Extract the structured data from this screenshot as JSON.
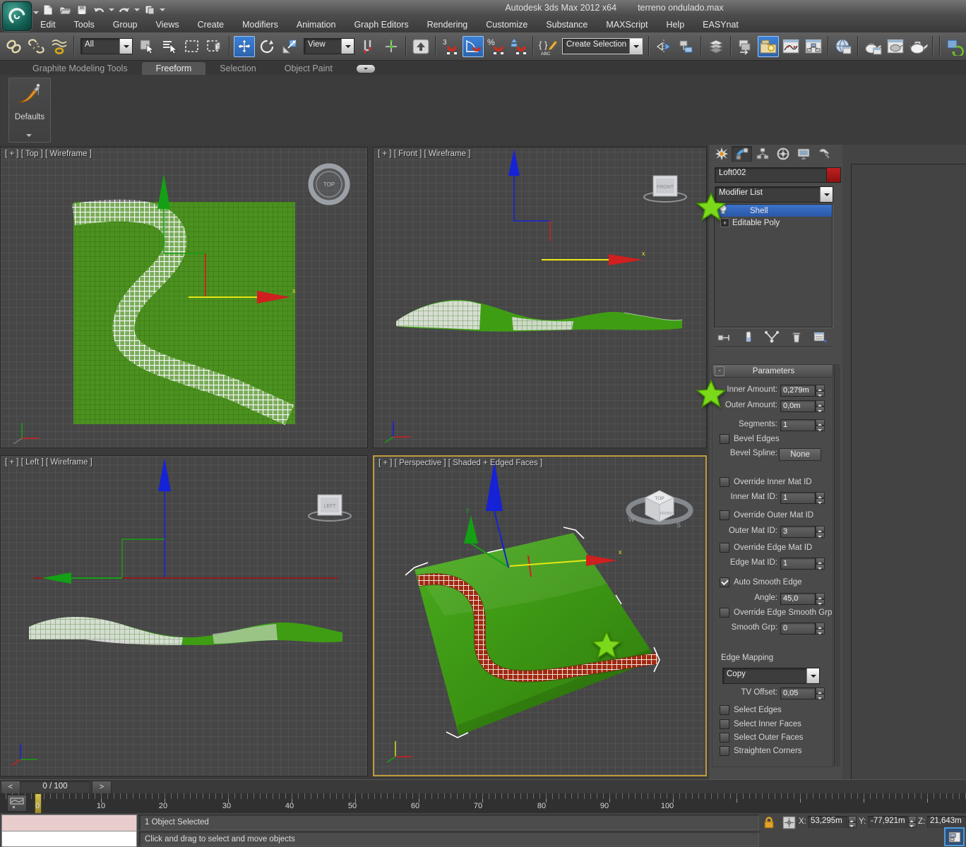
{
  "window": {
    "app_title": "Autodesk 3ds Max  2012 x64",
    "doc_title": "terreno ondulado.max"
  },
  "menu": {
    "items": [
      "Edit",
      "Tools",
      "Group",
      "Views",
      "Create",
      "Modifiers",
      "Animation",
      "Graph Editors",
      "Rendering",
      "Customize",
      "Substance",
      "MAXScript",
      "Help",
      "EASYnat"
    ]
  },
  "toolbar": {
    "selection_filter_value": "All",
    "ref_coord_value": "View",
    "named_selection_value": "Create Selection Se",
    "snap3_glyph": "3",
    "percent_glyph": "%",
    "abc_glyph": "ABC"
  },
  "ribbon": {
    "tabs": [
      "Graphite Modeling Tools",
      "Freeform",
      "Selection",
      "Object Paint"
    ],
    "defaults_label": "Defaults"
  },
  "viewports": {
    "top": {
      "label": "[ + ] [ Top ] [ Wireframe ]",
      "compass": "TOP",
      "axis_x": "x"
    },
    "front": {
      "label": "[ + ] [ Front ] [ Wireframe ]",
      "compass": "FRONT",
      "axis_x": "x"
    },
    "left": {
      "label": "[ + ] [ Left ] [ Wireframe ]",
      "compass": "LEFT"
    },
    "persp": {
      "label": "[ + ] [ Perspective ] [ Shaded + Edged Faces ]",
      "viewcube_top": "TOP",
      "viewcube_front": "FRONT",
      "viewcube_w": "W",
      "viewcube_s": "S",
      "axis_x": "x",
      "axis_y": "y"
    }
  },
  "command_panel": {
    "object_name": "Loft002",
    "modifier_list_label": "Modifier List",
    "stack_expand_glyph": "+",
    "stack": [
      {
        "label": "Shell"
      },
      {
        "label": "Editable Poly"
      }
    ],
    "rollout": {
      "collapse_glyph": "-",
      "title": "Parameters",
      "inner_amount_label": "Inner Amount:",
      "inner_amount_value": "0,279m",
      "outer_amount_label": "Outer Amount:",
      "outer_amount_value": "0,0m",
      "segments_label": "Segments:",
      "segments_value": "1",
      "bevel_edges_label": "Bevel Edges",
      "bevel_spline_label": "Bevel Spline:",
      "bevel_spline_value": "None",
      "override_inner_label": "Override Inner Mat ID",
      "inner_mat_label": "Inner Mat ID:",
      "inner_mat_value": "1",
      "override_outer_label": "Override Outer Mat ID",
      "outer_mat_label": "Outer Mat ID:",
      "outer_mat_value": "3",
      "override_edge_label": "Override Edge Mat ID",
      "edge_mat_label": "Edge Mat ID:",
      "edge_mat_value": "1",
      "auto_smooth_label": "Auto Smooth Edge",
      "angle_label": "Angle:",
      "angle_value": "45,0",
      "override_smooth_label": "Override Edge Smooth Grp",
      "smooth_grp_label": "Smooth Grp:",
      "smooth_grp_value": "0",
      "edge_mapping_label": "Edge Mapping",
      "edge_mapping_value": "Copy",
      "tv_offset_label": "TV Offset:",
      "tv_offset_value": "0,05",
      "select_edges_label": "Select Edges",
      "select_inner_label": "Select Inner Faces",
      "select_outer_label": "Select Outer Faces",
      "straighten_label": "Straighten Corners"
    }
  },
  "timeline": {
    "prev_glyph": "<",
    "next_glyph": ">",
    "frame_display": "0 / 100",
    "ticks": [
      "0",
      "10",
      "20",
      "30",
      "40",
      "50",
      "60",
      "70",
      "80",
      "90",
      "100"
    ]
  },
  "status": {
    "selection": "1 Object Selected",
    "prompt": "Click and drag to select and move objects",
    "x_label": "X:",
    "x_value": "53,295m",
    "y_label": "Y:",
    "y_value": "-77,921m",
    "z_label": "Z:",
    "z_value": "21,643m"
  },
  "colors": {
    "accent_blue": "#2d72c8",
    "selection_blue": "#2f64b4",
    "terrain_green": "#3f9d14",
    "road_red": "#a12810",
    "star_green": "#7cd81b",
    "active_viewport_border": "#c09a3c"
  }
}
